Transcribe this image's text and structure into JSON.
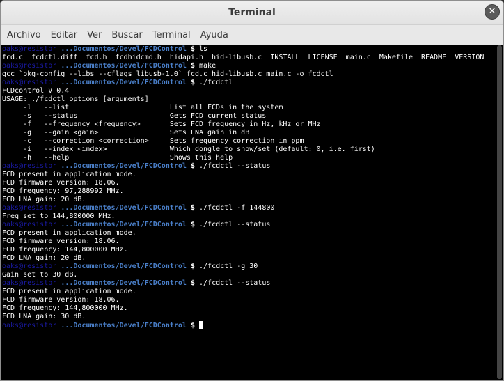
{
  "window": {
    "title": "Terminal",
    "close_glyph": "✕"
  },
  "menu": [
    "Archivo",
    "Editar",
    "Ver",
    "Buscar",
    "Terminal",
    "Ayuda"
  ],
  "prompt": {
    "user_host": "oaks@resistor",
    "path": "...Documentos/Devel/FCDControl",
    "symbol": "$ "
  },
  "lines": [
    {
      "type": "prompt",
      "cmd": "ls"
    },
    {
      "type": "out",
      "text": "fcd.c  fcdctl.diff  fcd.h  fcdhidcmd.h  hidapi.h  hid-libusb.c  INSTALL  LICENSE  main.c  Makefile  README  VERSION"
    },
    {
      "type": "prompt",
      "cmd": "make"
    },
    {
      "type": "out",
      "text": "gcc `pkg-config --libs --cflags libusb-1.0` fcd.c hid-libusb.c main.c -o fcdctl"
    },
    {
      "type": "prompt",
      "cmd": "./fcdctl"
    },
    {
      "type": "out",
      "text": "FCDcontrol V 0.4"
    },
    {
      "type": "out",
      "text": "USAGE: ./fcdctl options [arguments]"
    },
    {
      "type": "out",
      "text": "     -l   --list                        List all FCDs in the system"
    },
    {
      "type": "out",
      "text": "     -s   --status                      Gets FCD current status"
    },
    {
      "type": "out",
      "text": "     -f   --frequency <frequency>       Sets FCD frequency in Hz, kHz or MHz"
    },
    {
      "type": "out",
      "text": "     -g   --gain <gain>                 Sets LNA gain in dB"
    },
    {
      "type": "out",
      "text": "     -c   --correction <correction>     Sets frequency correction in ppm"
    },
    {
      "type": "out",
      "text": "     -i   --index <index>               Which dongle to show/set (default: 0, i.e. first)"
    },
    {
      "type": "out",
      "text": "     -h   --help                        Shows this help"
    },
    {
      "type": "prompt",
      "cmd": "./fcdctl --status"
    },
    {
      "type": "out",
      "text": "FCD present in application mode."
    },
    {
      "type": "out",
      "text": "FCD firmware version: 18.06."
    },
    {
      "type": "out",
      "text": "FCD frequency: 97,288992 MHz."
    },
    {
      "type": "out",
      "text": "FCD LNA gain: 20 dB."
    },
    {
      "type": "prompt",
      "cmd": "./fcdctl -f 144800"
    },
    {
      "type": "out",
      "text": "Freq set to 144,800000 MHz."
    },
    {
      "type": "prompt",
      "cmd": "./fcdctl --status"
    },
    {
      "type": "out",
      "text": "FCD present in application mode."
    },
    {
      "type": "out",
      "text": "FCD firmware version: 18.06."
    },
    {
      "type": "out",
      "text": "FCD frequency: 144,800000 MHz."
    },
    {
      "type": "out",
      "text": "FCD LNA gain: 20 dB."
    },
    {
      "type": "prompt",
      "cmd": "./fcdctl -g 30"
    },
    {
      "type": "out",
      "text": "Gain set to 30 dB."
    },
    {
      "type": "prompt",
      "cmd": "./fcdctl --status"
    },
    {
      "type": "out",
      "text": "FCD present in application mode."
    },
    {
      "type": "out",
      "text": "FCD firmware version: 18.06."
    },
    {
      "type": "out",
      "text": "FCD frequency: 144,800000 MHz."
    },
    {
      "type": "out",
      "text": "FCD LNA gain: 30 dB."
    },
    {
      "type": "prompt",
      "cmd": "",
      "cursor": true
    }
  ],
  "colors": {
    "user_host": "#1a1aa6",
    "path": "#4a7fc9",
    "background": "#000000",
    "text": "#ffffff"
  }
}
